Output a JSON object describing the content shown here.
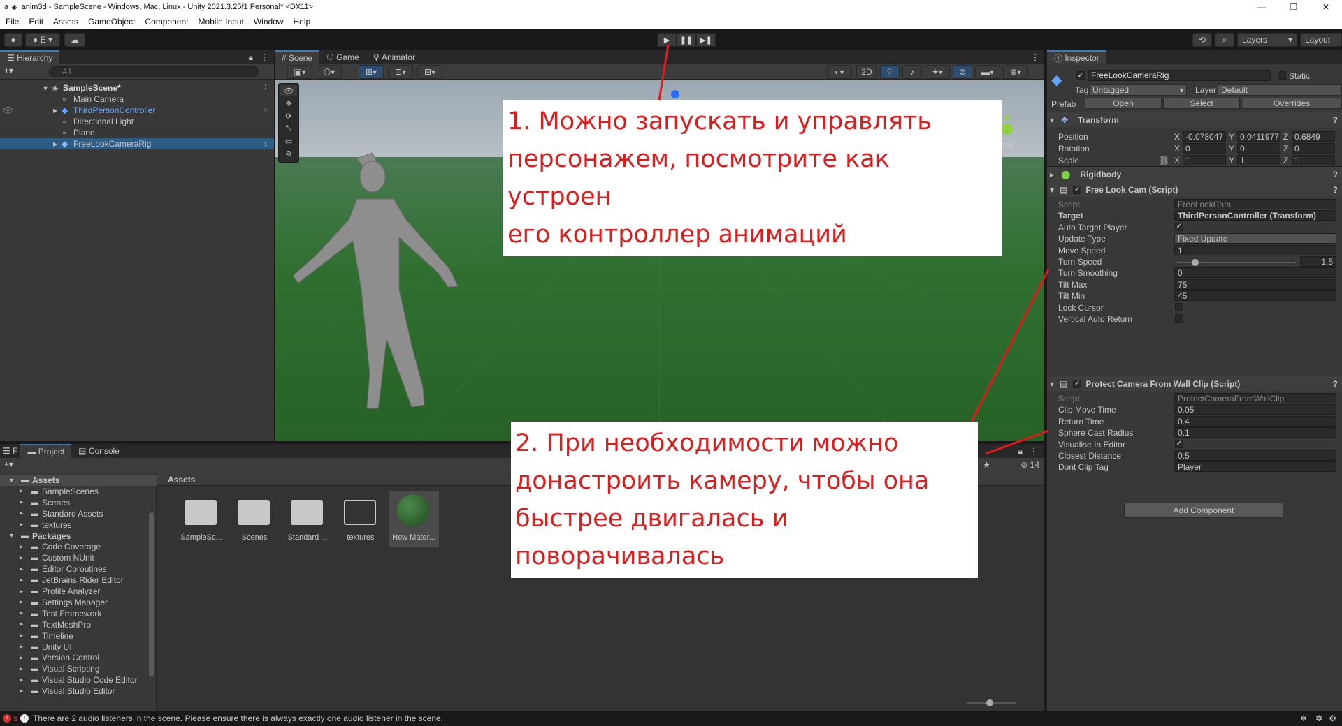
{
  "window": {
    "title": "anim3d - SampleScene - Windows, Mac, Linux - Unity 2021.3.25f1 Personal* <DX11>",
    "app_letter": "a",
    "minimize": "—",
    "restore": "❐",
    "close": "✕"
  },
  "menu": [
    "File",
    "Edit",
    "Assets",
    "GameObject",
    "Component",
    "Mobile Input",
    "Window",
    "Help"
  ],
  "toolbar": {
    "account_label": "E",
    "layers_label": "Layers",
    "layout_label": "Layout",
    "play": "▶",
    "pause": "❚❚",
    "step": "▶❚"
  },
  "hierarchy": {
    "tab_label": "Hierarchy",
    "search_placeholder": "All",
    "items": [
      {
        "label": "SampleScene*",
        "color": "#d8d8d8"
      },
      {
        "label": "Main Camera",
        "color": "#c4c4c4"
      },
      {
        "label": "ThirdPersonController",
        "color": "#6fa8ff"
      },
      {
        "label": "Directional Light",
        "color": "#c4c4c4"
      },
      {
        "label": "Plane",
        "color": "#c4c4c4"
      },
      {
        "label": "FreeLookCameraRig",
        "color": "#c4c4c4"
      }
    ]
  },
  "scene": {
    "tabs": [
      "Scene",
      "Game",
      "Animator"
    ],
    "mode_2d": "2D",
    "persp_label": "ersp",
    "ground_color": "#2c6b2c"
  },
  "inspector": {
    "tab_label": "Inspector",
    "object_name": "FreeLookCameraRig",
    "static_label": "Static",
    "tag_label": "Tag",
    "tag_value": "Untagged",
    "layer_label": "Layer",
    "layer_value": "Default",
    "prefab_label": "Prefab",
    "prefab_open": "Open",
    "prefab_select": "Select",
    "prefab_overrides": "Overrides",
    "transform": {
      "title": "Transform",
      "position_label": "Position",
      "rotation_label": "Rotation",
      "scale_label": "Scale",
      "position": {
        "x": "-0.078047",
        "y": "0.0411977",
        "z": "0.6849"
      },
      "rotation": {
        "x": "0",
        "y": "0",
        "z": "0"
      },
      "scale": {
        "x": "1",
        "y": "1",
        "z": "1"
      }
    },
    "rigidbody_title": "Rigidbody",
    "free_look": {
      "title": "Free Look Cam (Script)",
      "script_label": "Script",
      "script_value": "FreeLookCam",
      "target_label": "Target",
      "target_value": "ThirdPersonController (Transform)",
      "auto_target_label": "Auto Target Player",
      "auto_target_checked": "✓",
      "update_type_label": "Update Type",
      "update_type_value": "Fixed Update",
      "move_speed_label": "Move Speed",
      "move_speed_value": "1",
      "turn_speed_label": "Turn Speed",
      "turn_speed_value": "1.5",
      "turn_speed_fraction": 0.15,
      "turn_smoothing_label": "Turn Smoothing",
      "turn_smoothing_value": "0",
      "tilt_max_label": "Tilt Max",
      "tilt_max_value": "75",
      "tilt_min_label": "Tilt Min",
      "tilt_min_value": "45",
      "lock_cursor_label": "Lock Cursor",
      "vertical_auto_return_label": "Vertical Auto Return"
    },
    "protect_camera": {
      "title": "Protect Camera From Wall Clip (Script)",
      "script_label": "Script",
      "script_value": "ProtectCameraFromWallClip",
      "clip_move_time_label": "Clip Move Time",
      "clip_move_time_value": "0.05",
      "return_time_label": "Return Time",
      "return_time_value": "0.4",
      "sphere_cast_radius_label": "Sphere Cast Radius",
      "sphere_cast_radius_value": "0.1",
      "visualise_label": "Visualise In Editor",
      "visualise_checked": "✓",
      "closest_distance_label": "Closest Distance",
      "closest_distance_value": "0.5",
      "dont_clip_tag_label": "Dont Clip Tag",
      "dont_clip_tag_value": "Player"
    },
    "add_component": "Add Component"
  },
  "project": {
    "tab_project": "Project",
    "tab_console": "Console",
    "tab_f": "F",
    "breadcrumb": "Assets",
    "hidden_count": "14",
    "tree": [
      {
        "label": "Assets",
        "indent": 0,
        "bold": true
      },
      {
        "label": "SampleScenes",
        "indent": 1
      },
      {
        "label": "Scenes",
        "indent": 1
      },
      {
        "label": "Standard Assets",
        "indent": 1
      },
      {
        "label": "textures",
        "indent": 1
      },
      {
        "label": "Packages",
        "indent": 0,
        "bold": true
      },
      {
        "label": "Code Coverage",
        "indent": 1
      },
      {
        "label": "Custom NUnit",
        "indent": 1
      },
      {
        "label": "Editor Coroutines",
        "indent": 1
      },
      {
        "label": "JetBrains Rider Editor",
        "indent": 1
      },
      {
        "label": "Profile Analyzer",
        "indent": 1
      },
      {
        "label": "Settings Manager",
        "indent": 1
      },
      {
        "label": "Test Framework",
        "indent": 1
      },
      {
        "label": "TextMeshPro",
        "indent": 1
      },
      {
        "label": "Timeline",
        "indent": 1
      },
      {
        "label": "Unity UI",
        "indent": 1
      },
      {
        "label": "Version Control",
        "indent": 1
      },
      {
        "label": "Visual Scripting",
        "indent": 1
      },
      {
        "label": "Visual Studio Code Editor",
        "indent": 1
      },
      {
        "label": "Visual Studio Editor",
        "indent": 1
      }
    ],
    "assets": [
      {
        "label": "SampleSc...",
        "kind": "folder"
      },
      {
        "label": "Scenes",
        "kind": "folder"
      },
      {
        "label": "Standard ...",
        "kind": "folder"
      },
      {
        "label": "textures",
        "kind": "folder-empty"
      },
      {
        "label": "New Mater...",
        "kind": "material"
      }
    ]
  },
  "status": {
    "message": "There are 2 audio listeners in the scene. Please ensure there is always exactly one audio listener in the scene.",
    "error_icon_letter": "!",
    "error_label": "s"
  },
  "annotations": {
    "note1": [
      "1. Можно запускать и управлять",
      "персонажем, посмотрите как устроен",
      "его контроллер анимаций"
    ],
    "note2": [
      "2. При необходимости можно",
      "донастроить камеру, чтобы она",
      "быстрее двигалась и",
      "поворачивалась"
    ],
    "color": "#e01b1b"
  }
}
